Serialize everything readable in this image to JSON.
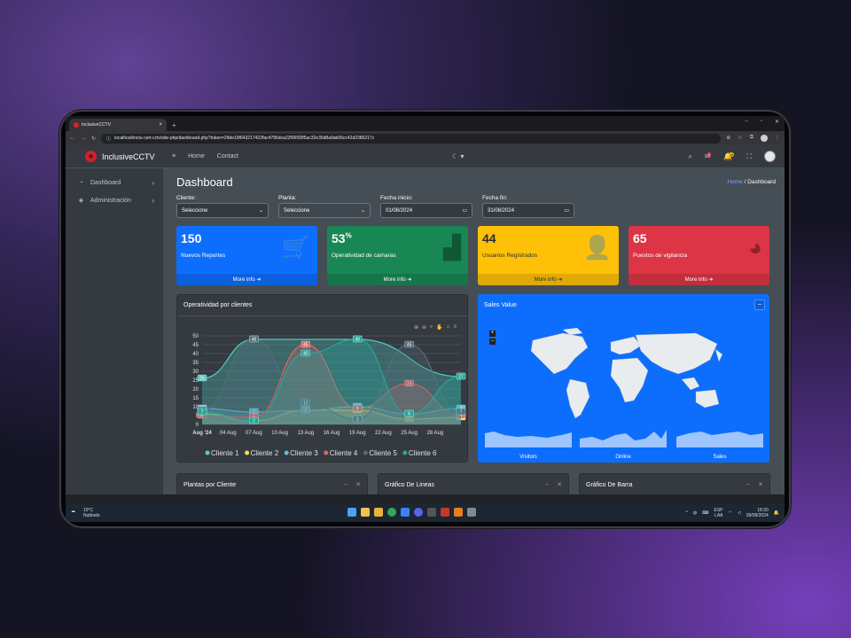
{
  "browser": {
    "tab_title": "InclusiveCCTV",
    "url": "localhost/inclu-cert-cctv/site-php/dashboard.php?token=29de19f643217422fac4786dca22f06f20f5ac32e35d8a9ab06cc42d2386217c"
  },
  "brand": "InclusiveCCTV",
  "sidebar": {
    "items": [
      {
        "label": "Dashboard"
      },
      {
        "label": "Administración"
      }
    ]
  },
  "topnav": {
    "home": "Home",
    "contact": "Contact",
    "notif_msgs": "3",
    "notif_warn": "15"
  },
  "page": {
    "title": "Dashboard",
    "breadcrumb_home": "Home",
    "breadcrumb_current": "Dashboard"
  },
  "filters": {
    "cliente_label": "Cliente:",
    "cliente_value": "Seleccione",
    "planta_label": "Planta:",
    "planta_value": "Seleccione",
    "inicio_label": "Fecha inicio:",
    "inicio_value": "01/08/2024",
    "fin_label": "Fecha fin:",
    "fin_value": "31/08/2024"
  },
  "boxes": [
    {
      "value": "150",
      "label": "Nuevos Reportes",
      "more": "More info"
    },
    {
      "value": "53",
      "unit": "%",
      "label": "Operatividad de camaras",
      "more": "More info"
    },
    {
      "value": "44",
      "label": "Usuarios Registrados",
      "more": "More info"
    },
    {
      "value": "65",
      "label": "Puestos de vigilancia",
      "more": "More info"
    }
  ],
  "chart_card": {
    "title": "Operatividad por clientes"
  },
  "map_card": {
    "title": "Sales Value",
    "spark_labels": [
      "Visitors",
      "Online",
      "Sales"
    ]
  },
  "bottom_cards": [
    "Plantas por Cliente",
    "Gráfico De Lineas",
    "Gráfico De Barra"
  ],
  "taskbar": {
    "temp": "19°C",
    "weather": "Nublado",
    "lang": "ESP",
    "lang2": "LAA",
    "time": "18:20",
    "date": "09/08/2024"
  },
  "colors": {
    "accent": "#0d6efd",
    "success": "#198754",
    "warning": "#ffc107",
    "danger": "#dc3545"
  },
  "chart_data": {
    "type": "area",
    "x": [
      "Aug '24",
      "04 Aug",
      "07 Aug",
      "10 Aug",
      "13 Aug",
      "16 Aug",
      "19 Aug",
      "22 Aug",
      "25 Aug",
      "28 Aug"
    ],
    "ylim": [
      0,
      50
    ],
    "yticks": [
      0,
      5,
      10,
      15,
      20,
      25,
      30,
      35,
      40,
      45,
      50
    ],
    "series": [
      {
        "name": "Cliente 1",
        "color": "#4ecdc4",
        "points": [
          [
            1,
            26
          ],
          [
            7,
            48
          ],
          [
            19,
            48
          ],
          [
            31,
            27
          ]
        ]
      },
      {
        "name": "Cliente 2",
        "color": "#f4e04d",
        "points": [
          [
            1,
            6
          ],
          [
            7,
            2
          ],
          [
            13,
            8
          ],
          [
            19,
            8
          ],
          [
            25,
            3
          ],
          [
            31,
            4
          ]
        ]
      },
      {
        "name": "Cliente 3",
        "color": "#5bc0de",
        "points": [
          [
            1,
            9
          ],
          [
            7,
            7
          ],
          [
            13,
            8
          ],
          [
            19,
            10
          ],
          [
            25,
            6
          ],
          [
            31,
            9
          ]
        ]
      },
      {
        "name": "Cliente 4",
        "color": "#e06666",
        "points": [
          [
            1,
            5
          ],
          [
            7,
            4
          ],
          [
            13,
            45
          ],
          [
            19,
            9
          ],
          [
            25,
            23
          ],
          [
            31,
            5
          ]
        ]
      },
      {
        "name": "Cliente 5",
        "color": "#546e7a",
        "points": [
          [
            1,
            8
          ],
          [
            7,
            48
          ],
          [
            13,
            12
          ],
          [
            19,
            3
          ],
          [
            25,
            45
          ],
          [
            31,
            7
          ]
        ]
      },
      {
        "name": "Cliente 6",
        "color": "#26a69a",
        "points": [
          [
            1,
            7
          ],
          [
            7,
            2
          ],
          [
            13,
            40
          ],
          [
            19,
            48
          ],
          [
            25,
            6
          ],
          [
            31,
            27
          ]
        ]
      }
    ],
    "annotations": [
      "48",
      "45",
      "40",
      "48",
      "45",
      "27",
      "26",
      "23",
      "19",
      "12",
      "10",
      "9",
      "8",
      "7",
      "6",
      "5",
      "3",
      "2"
    ]
  }
}
